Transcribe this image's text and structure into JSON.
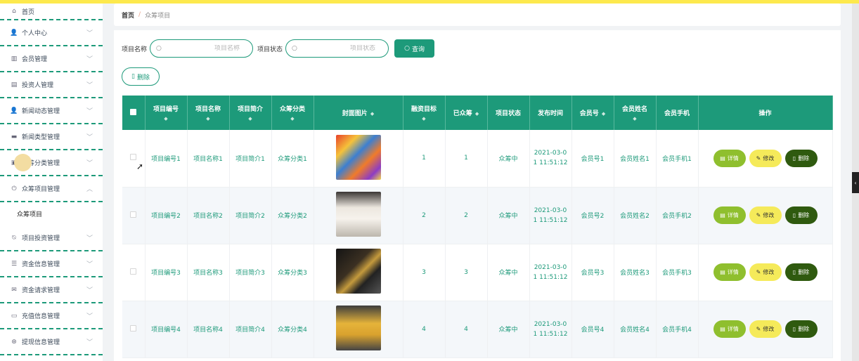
{
  "breadcrumb": {
    "home": "首页",
    "separator": "/",
    "current": "众筹项目"
  },
  "sidebar": {
    "items": [
      {
        "label": "首页",
        "icon": "home-icon",
        "glyph": "⌂",
        "chevron": false
      },
      {
        "label": "个人中心",
        "icon": "user-icon",
        "glyph": "👤",
        "chevron": true
      },
      {
        "label": "会员管理",
        "icon": "chart-icon",
        "glyph": "▥",
        "chevron": true
      },
      {
        "label": "投资人管理",
        "icon": "report-icon",
        "glyph": "▤",
        "chevron": true
      },
      {
        "label": "新闻动态管理",
        "icon": "user-icon",
        "glyph": "👤",
        "chevron": true
      },
      {
        "label": "新闻类型管理",
        "icon": "message-icon",
        "glyph": "▬",
        "chevron": true
      },
      {
        "label": "众筹分类管理",
        "icon": "clipboard-icon",
        "glyph": "▣",
        "chevron": true
      },
      {
        "label": "众筹项目管理",
        "icon": "power-icon",
        "glyph": "⏻",
        "chevron": "up",
        "sub": "众筹项目"
      },
      {
        "label": "项目投资管理",
        "icon": "bell-off-icon",
        "glyph": "⍉",
        "chevron": true
      },
      {
        "label": "资金信息管理",
        "icon": "list-icon",
        "glyph": "☰",
        "chevron": true
      },
      {
        "label": "资金请求管理",
        "icon": "mail-icon",
        "glyph": "✉",
        "chevron": true
      },
      {
        "label": "充值信息管理",
        "icon": "wallet-icon",
        "glyph": "▭",
        "chevron": true
      },
      {
        "label": "提现信息管理",
        "icon": "wheel-icon",
        "glyph": "⊛",
        "chevron": true
      }
    ]
  },
  "filters": {
    "name_label": "项目名称",
    "name_placeholder": "项目名称",
    "status_label": "项目状态",
    "status_placeholder": "项目状态",
    "search_button": "查询",
    "delete_button": "删除"
  },
  "table": {
    "headers": [
      "项目编号",
      "项目名称",
      "项目简介",
      "众筹分类",
      "封面图片",
      "融资目标",
      "已众筹",
      "项目状态",
      "发布时间",
      "会员号",
      "会员姓名",
      "会员手机",
      "操作"
    ],
    "rows": [
      {
        "id": "项目编号1",
        "name": "项目名称1",
        "intro": "项目简介1",
        "category": "众筹分类1",
        "target": "1",
        "raised": "1",
        "status": "众筹中",
        "time_a": "2021-03-0",
        "time_b": "1 11:51:12",
        "member": "会员号1",
        "mname": "会员姓名1",
        "phone": "会员手机1"
      },
      {
        "id": "项目编号2",
        "name": "项目名称2",
        "intro": "项目简介2",
        "category": "众筹分类2",
        "target": "2",
        "raised": "2",
        "status": "众筹中",
        "time_a": "2021-03-0",
        "time_b": "1 11:51:12",
        "member": "会员号2",
        "mname": "会员姓名2",
        "phone": "会员手机2"
      },
      {
        "id": "项目编号3",
        "name": "项目名称3",
        "intro": "项目简介3",
        "category": "众筹分类3",
        "target": "3",
        "raised": "3",
        "status": "众筹中",
        "time_a": "2021-03-0",
        "time_b": "1 11:51:12",
        "member": "会员号3",
        "mname": "会员姓名3",
        "phone": "会员手机3"
      },
      {
        "id": "项目编号4",
        "name": "项目名称4",
        "intro": "项目简介4",
        "category": "众筹分类4",
        "target": "4",
        "raised": "4",
        "status": "众筹中",
        "time_a": "2021-03-0",
        "time_b": "1 11:51:12",
        "member": "会员号4",
        "mname": "会员姓名4",
        "phone": "会员手机4"
      }
    ],
    "actions": {
      "detail": "详情",
      "edit": "修改",
      "delete": "删除"
    }
  },
  "colors": {
    "primary": "#1d9a7a",
    "topbar": "#fde94d",
    "detail": "#8fbf2e",
    "edit": "#f5ea5a",
    "delete": "#2f5a0f"
  }
}
